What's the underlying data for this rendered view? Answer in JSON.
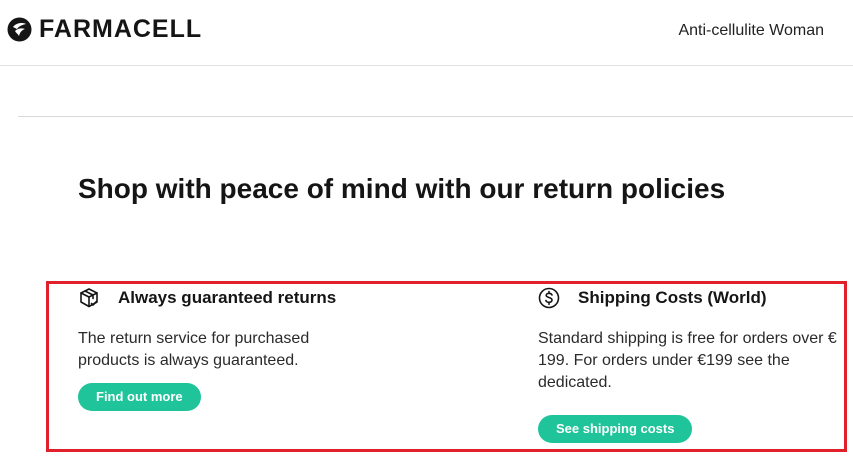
{
  "header": {
    "brand": "FARMACELL",
    "nav_link": "Anti-cellulite Woman"
  },
  "section": {
    "title": "Shop with peace of mind with our return policies"
  },
  "features": [
    {
      "icon": "package-icon",
      "title": "Always guaranteed returns",
      "text": "The return service for purchased products is always guaranteed.",
      "button": "Find out more"
    },
    {
      "icon": "dollar-circle-icon",
      "title": "Shipping Costs (World)",
      "text": "Standard shipping is free for orders over € 199. For orders under €199 see the dedicated.",
      "button": "See shipping costs"
    }
  ],
  "colors": {
    "accent": "#1fc49a",
    "highlight": "#e0202a",
    "text": "#151515"
  }
}
